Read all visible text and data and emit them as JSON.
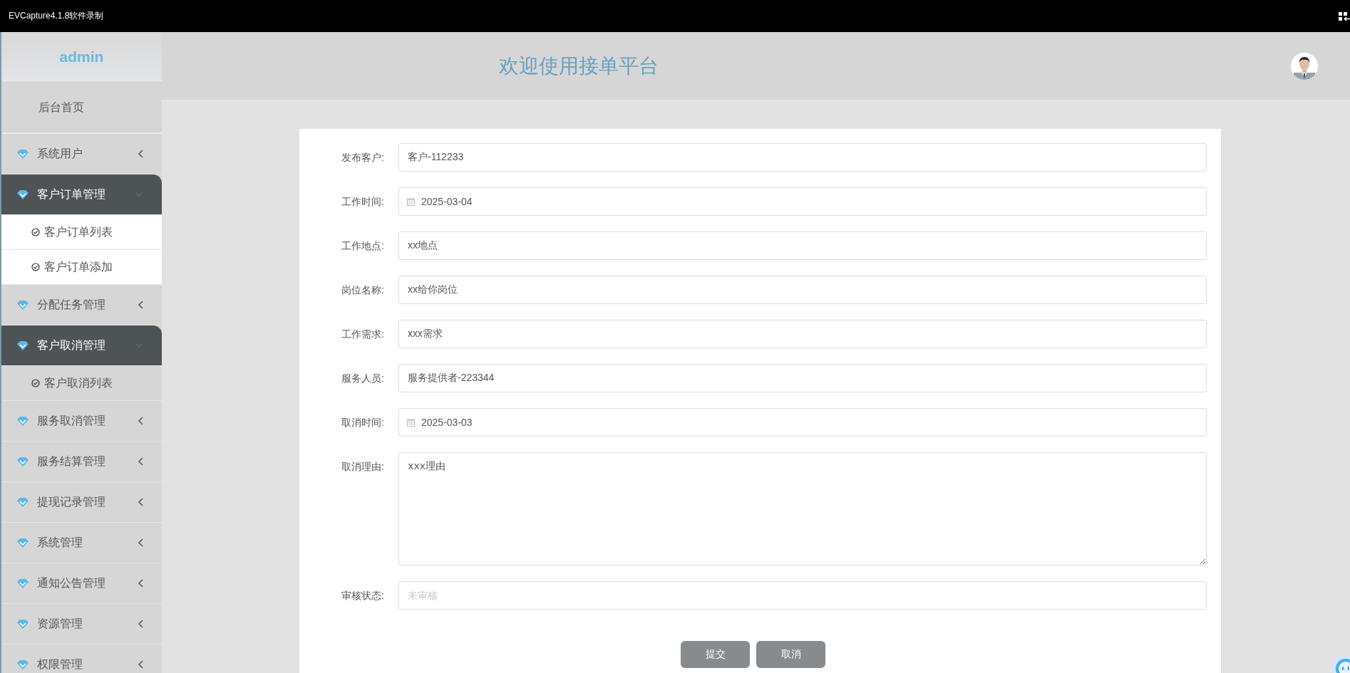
{
  "capture_bar": {
    "title": "EVCapture4.1.8软件录制"
  },
  "sidebar": {
    "user": "admin",
    "home": "后台首页",
    "items": [
      {
        "label": "系统用户",
        "expanded": false
      },
      {
        "label": "客户订单管理",
        "expanded": true,
        "children": [
          {
            "label": "客户订单列表",
            "selected": true
          },
          {
            "label": "客户订单添加",
            "selected": true
          }
        ]
      },
      {
        "label": "分配任务管理",
        "expanded": false
      },
      {
        "label": "客户取消管理",
        "expanded": true,
        "children": [
          {
            "label": "客户取消列表",
            "selected": false
          }
        ]
      },
      {
        "label": "服务取消管理",
        "expanded": false
      },
      {
        "label": "服务结算管理",
        "expanded": false
      },
      {
        "label": "提现记录管理",
        "expanded": false
      },
      {
        "label": "系统管理",
        "expanded": false
      },
      {
        "label": "通知公告管理",
        "expanded": false
      },
      {
        "label": "资源管理",
        "expanded": false
      },
      {
        "label": "权限管理",
        "expanded": false
      }
    ]
  },
  "header": {
    "title": "欢迎使用接单平台"
  },
  "form": {
    "fields": [
      {
        "label": "发布客户:",
        "kind": "text",
        "value": "客户-112233"
      },
      {
        "label": "工作时间:",
        "kind": "date",
        "value": "2025-03-04"
      },
      {
        "label": "工作地点:",
        "kind": "text",
        "value": "xx地点"
      },
      {
        "label": "岗位名称:",
        "kind": "text",
        "value": "xx给你岗位"
      },
      {
        "label": "工作需求:",
        "kind": "text",
        "value": "xxx需求"
      },
      {
        "label": "服务人员:",
        "kind": "text",
        "value": "服务提供者-223344"
      },
      {
        "label": "取消时间:",
        "kind": "date",
        "value": "2025-03-03"
      },
      {
        "label": "取消理由:",
        "kind": "textarea",
        "value": "xxx理由"
      },
      {
        "label": "审核状态:",
        "kind": "text",
        "placeholder": "未审核"
      }
    ],
    "buttons": [
      "提交",
      "取消"
    ]
  }
}
